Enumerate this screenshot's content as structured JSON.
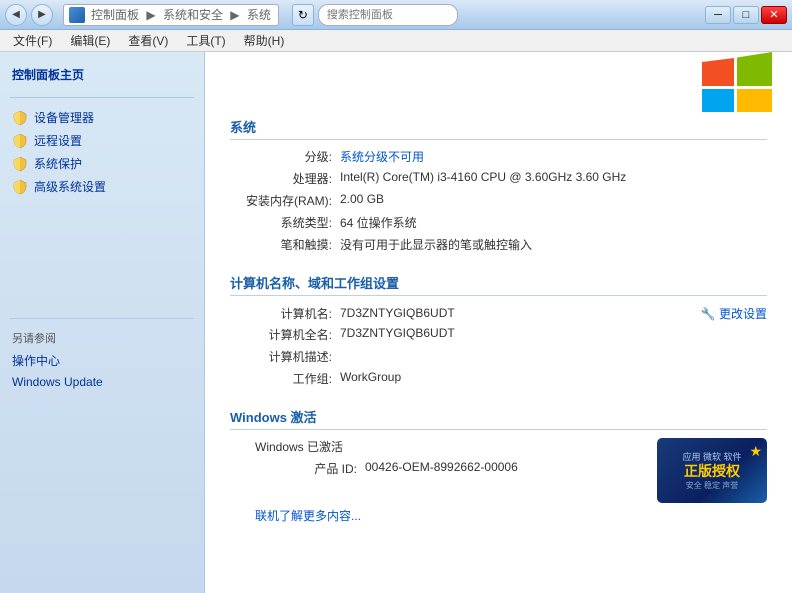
{
  "titlebar": {
    "back_icon": "◀",
    "forward_icon": "▶",
    "address": {
      "prefix": "控制面板",
      "sep1": "▶",
      "middle": "系统和安全",
      "sep2": "▶",
      "current": "系统"
    },
    "refresh_icon": "↻",
    "search_placeholder": "搜索控制面板",
    "minimize": "─",
    "maximize": "□",
    "close": "✕"
  },
  "menubar": {
    "items": [
      {
        "label": "文件(F)"
      },
      {
        "label": "编辑(E)"
      },
      {
        "label": "查看(V)"
      },
      {
        "label": "工具(T)"
      },
      {
        "label": "帮助(H)"
      }
    ]
  },
  "sidebar": {
    "main_link": "控制面板主页",
    "items": [
      {
        "label": "设备管理器"
      },
      {
        "label": "远程设置"
      },
      {
        "label": "系统保护"
      },
      {
        "label": "高级系统设置"
      }
    ],
    "also_see_label": "另请参阅",
    "also_see_items": [
      {
        "label": "操作中心"
      },
      {
        "label": "Windows Update"
      }
    ]
  },
  "system": {
    "section_title": "系统",
    "rating_label": "分级:",
    "rating_value": "系统分级不可用",
    "cpu_label": "处理器:",
    "cpu_value": "Intel(R) Core(TM) i3-4160 CPU @ 3.60GHz   3.60 GHz",
    "ram_label": "安装内存(RAM):",
    "ram_value": "2.00 GB",
    "type_label": "系统类型:",
    "type_value": "64 位操作系统",
    "pen_label": "笔和触摸:",
    "pen_value": "没有可用于此显示器的笔或触控输入"
  },
  "computer": {
    "section_title": "计算机名称、域和工作组设置",
    "name_label": "计算机名:",
    "name_value": "7D3ZNTYGIQB6UDT",
    "fullname_label": "计算机全名:",
    "fullname_value": "7D3ZNTYGIQB6UDT",
    "desc_label": "计算机描述:",
    "desc_value": "",
    "workgroup_label": "工作组:",
    "workgroup_value": "WorkGroup",
    "change_link": "🔧 更改设置"
  },
  "activation": {
    "section_title": "Windows 激活",
    "status": "Windows 已激活",
    "product_id_label": "产品 ID:",
    "product_id_value": "00426-OEM-8992662-00006",
    "badge_line1": "应用 微软 软件",
    "badge_line2": "正版授权",
    "badge_line3": "安全 稳定 声誉",
    "more_link": "联机了解更多内容..."
  }
}
